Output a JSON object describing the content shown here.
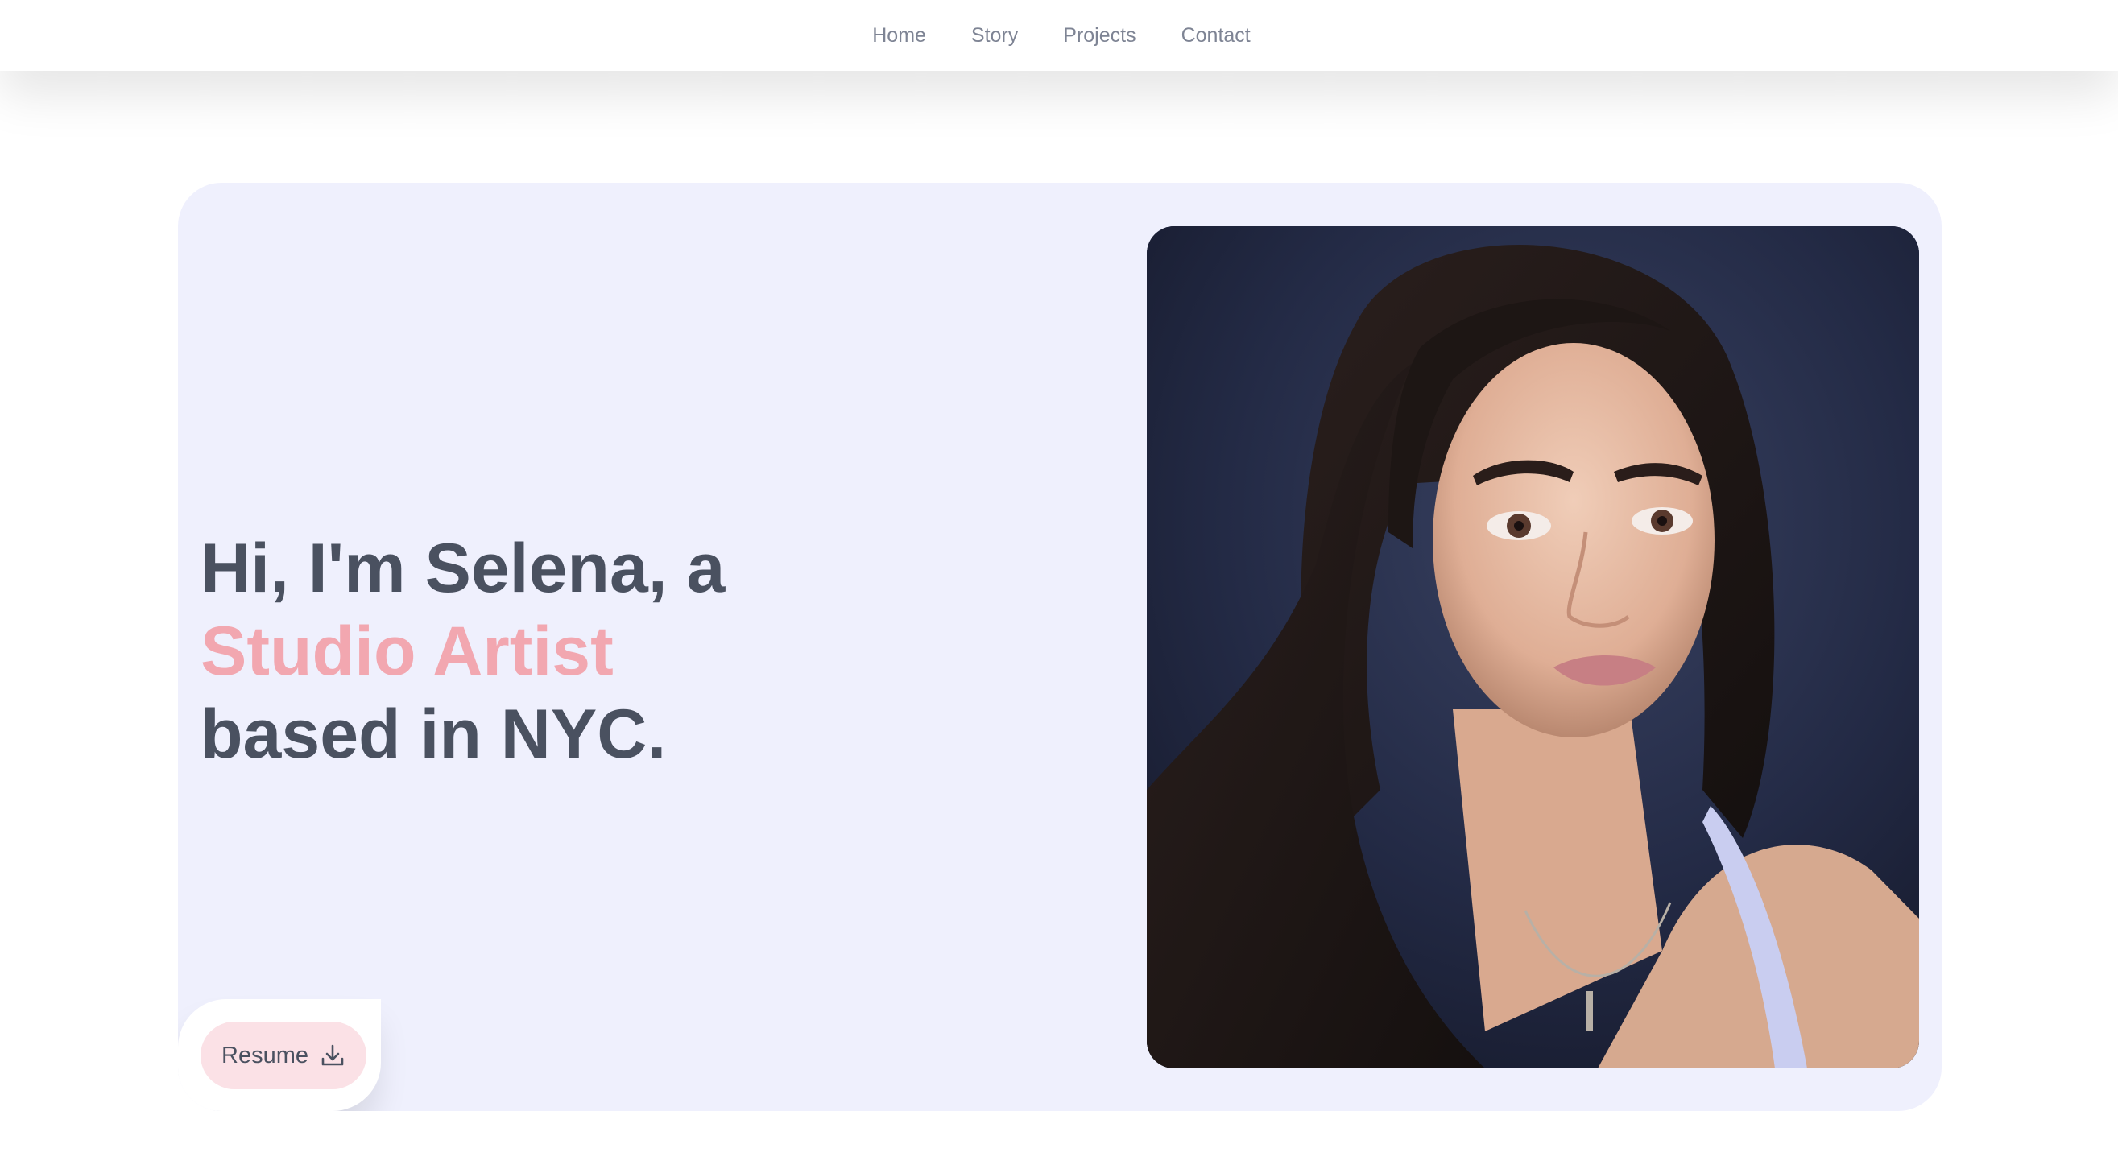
{
  "nav": {
    "items": [
      {
        "label": "Home"
      },
      {
        "label": "Story"
      },
      {
        "label": "Projects"
      },
      {
        "label": "Contact"
      }
    ]
  },
  "hero": {
    "line1": "Hi, I'm Selena, a",
    "line2": "Studio Artist",
    "line3": "based in NYC.",
    "resume_label": "Resume",
    "resume_icon": "download-icon"
  },
  "colors": {
    "card_background": "#eff0fd",
    "heading_text": "#4a5160",
    "accent": "#f2a7b0",
    "button_background": "#fbe1e6",
    "nav_text": "#7e8494"
  }
}
